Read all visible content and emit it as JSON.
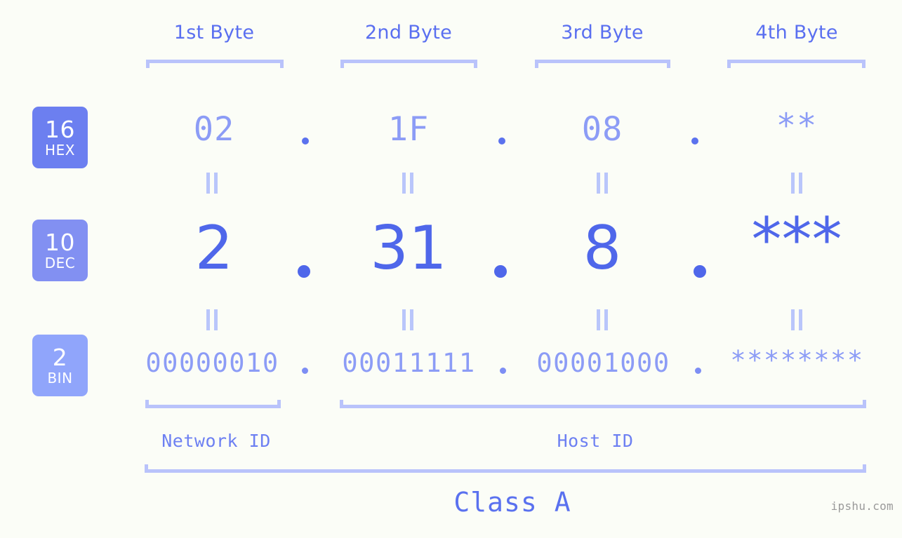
{
  "page": {
    "background_color": "#fbfdf7",
    "accent_color": "#4f67ea",
    "light_accent_color": "#8c9cf6",
    "bracket_color": "#b9c3fb",
    "watermark": "ipshu.com"
  },
  "byte_headers": [
    {
      "label": "1st Byte"
    },
    {
      "label": "2nd Byte"
    },
    {
      "label": "3rd Byte"
    },
    {
      "label": "4th Byte"
    }
  ],
  "rows": [
    {
      "badge_number": "16",
      "badge_name": "HEX",
      "badge_color": "#6c7ff0",
      "values": [
        "02",
        "1F",
        "08",
        "**"
      ],
      "separator": "."
    },
    {
      "badge_number": "10",
      "badge_name": "DEC",
      "badge_color": "#8290f2",
      "values": [
        "2",
        "31",
        "8",
        "***"
      ],
      "separator": "."
    },
    {
      "badge_number": "2",
      "badge_name": "BIN",
      "badge_color": "#90a5fb",
      "values": [
        "00000010",
        "00011111",
        "00001000",
        "********"
      ],
      "separator": "."
    }
  ],
  "equals_symbol": "=",
  "sections": [
    {
      "label": "Network ID"
    },
    {
      "label": "Host ID"
    }
  ],
  "class": {
    "label": "Class A"
  }
}
